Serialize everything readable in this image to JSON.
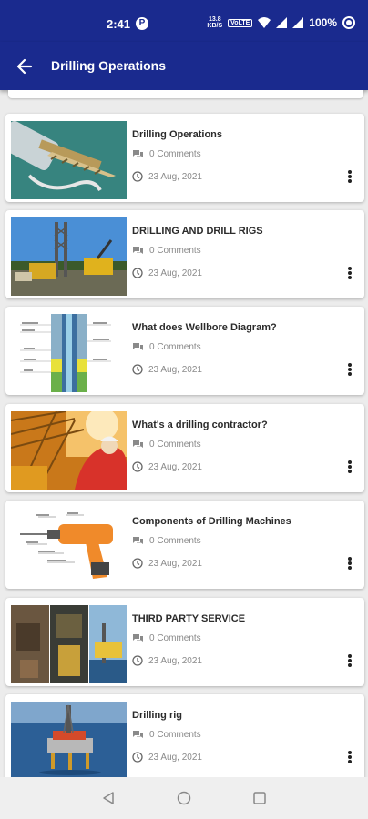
{
  "status_bar": {
    "time": "2:41",
    "notification_glyph": "P",
    "network_speed_top": "13.8",
    "network_speed_bottom": "KB/S",
    "volte_label": "VoLTE",
    "battery": "100%"
  },
  "app_bar": {
    "title": "Drilling Operations",
    "back_icon": "arrow-left-icon"
  },
  "icons": {
    "comments": "chat-bubbles-icon",
    "date": "clock-icon",
    "more": "more-vertical-icon"
  },
  "posts": [
    {
      "title": "Drilling Operations",
      "comments": "0 Comments",
      "date": "23 Aug, 2021",
      "thumb": "drill-bit-image"
    },
    {
      "title": "DRILLING AND DRILL RIGS",
      "comments": "0 Comments",
      "date": "23 Aug, 2021",
      "thumb": "drill-rig-site-image"
    },
    {
      "title": "What does Wellbore Diagram?",
      "comments": "0 Comments",
      "date": "23 Aug, 2021",
      "thumb": "wellbore-diagram-image"
    },
    {
      "title": "What's a drilling contractor?",
      "comments": "0 Comments",
      "date": "23 Aug, 2021",
      "thumb": "rig-worker-image"
    },
    {
      "title": "Components of Drilling Machines",
      "comments": "0 Comments",
      "date": "23 Aug, 2021",
      "thumb": "power-drill-diagram-image"
    },
    {
      "title": "THIRD PARTY SERVICE",
      "comments": "0 Comments",
      "date": "23 Aug, 2021",
      "thumb": "service-collage-image"
    },
    {
      "title": "Drilling rig",
      "comments": "0 Comments",
      "date": "23 Aug, 2021",
      "thumb": "offshore-rig-image"
    }
  ],
  "colors": {
    "primary": "#1a2a8e",
    "background": "#ececec",
    "card": "#ffffff",
    "meta_text": "#8a8a8a",
    "title_text": "#2b2b2b"
  }
}
